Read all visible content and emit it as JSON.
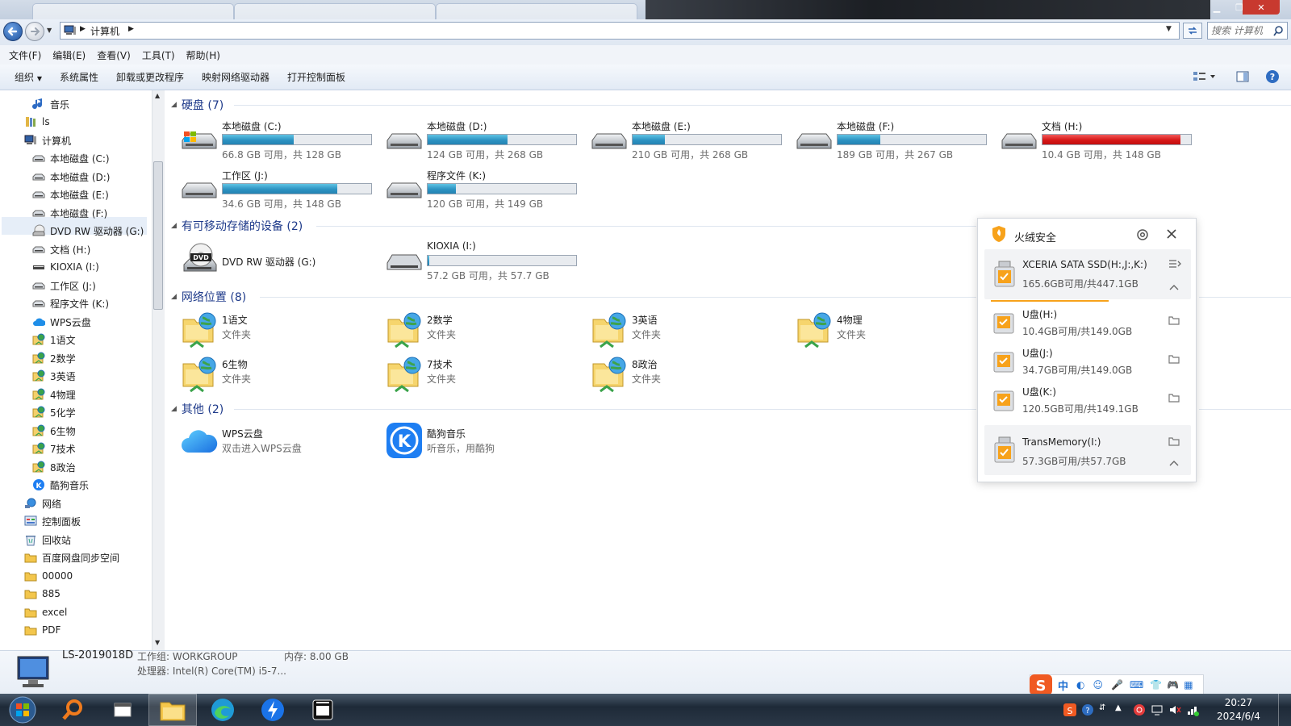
{
  "window": {
    "address_path": "计算机",
    "search_placeholder": "搜索 计算机"
  },
  "menu": [
    "文件(F)",
    "编辑(E)",
    "查看(V)",
    "工具(T)",
    "帮助(H)"
  ],
  "toolbar": {
    "organize": "组织",
    "items": [
      "系统属性",
      "卸载或更改程序",
      "映射网络驱动器",
      "打开控制面板"
    ]
  },
  "nav": [
    {
      "label": "音乐",
      "icon": "music-icon"
    },
    {
      "label": "ls",
      "icon": "library-icon"
    },
    {
      "label": "计算机",
      "icon": "computer-icon"
    },
    {
      "label": "本地磁盘 (C:)",
      "icon": "drive-icon"
    },
    {
      "label": "本地磁盘 (D:)",
      "icon": "drive-icon"
    },
    {
      "label": "本地磁盘 (E:)",
      "icon": "drive-icon"
    },
    {
      "label": "本地磁盘 (F:)",
      "icon": "drive-icon"
    },
    {
      "label": "DVD RW 驱动器 (G:)",
      "icon": "dvd-icon"
    },
    {
      "label": "文档 (H:)",
      "icon": "drive-icon"
    },
    {
      "label": "KIOXIA (I:)",
      "icon": "usb-drive-icon"
    },
    {
      "label": "工作区 (J:)",
      "icon": "drive-icon"
    },
    {
      "label": "程序文件 (K:)",
      "icon": "drive-icon"
    },
    {
      "label": "WPS云盘",
      "icon": "cloud-icon"
    },
    {
      "label": "1语文",
      "icon": "network-folder-icon"
    },
    {
      "label": "2数学",
      "icon": "network-folder-icon"
    },
    {
      "label": "3英语",
      "icon": "network-folder-icon"
    },
    {
      "label": "4物理",
      "icon": "network-folder-icon"
    },
    {
      "label": "5化学",
      "icon": "network-folder-icon"
    },
    {
      "label": "6生物",
      "icon": "network-folder-icon"
    },
    {
      "label": "7技术",
      "icon": "network-folder-icon"
    },
    {
      "label": "8政治",
      "icon": "network-folder-icon"
    },
    {
      "label": "酷狗音乐",
      "icon": "kugou-icon"
    },
    {
      "label": "网络",
      "icon": "network-icon"
    },
    {
      "label": "控制面板",
      "icon": "control-panel-icon"
    },
    {
      "label": "回收站",
      "icon": "recycle-bin-icon"
    },
    {
      "label": "百度网盘同步空间",
      "icon": "folder-icon"
    },
    {
      "label": "00000",
      "icon": "folder-icon"
    },
    {
      "label": "885",
      "icon": "folder-icon"
    },
    {
      "label": "excel",
      "icon": "folder-icon"
    },
    {
      "label": "PDF",
      "icon": "folder-icon"
    }
  ],
  "groups": {
    "hard_disks": "硬盘 (7)",
    "removable": "有可移动存储的设备 (2)",
    "network": "网络位置 (8)",
    "other": "其他 (2)"
  },
  "drives": [
    {
      "name": "本地磁盘 (C:)",
      "free": "66.8 GB 可用，共 128 GB",
      "used_fraction": 0.48,
      "status": "normal",
      "icon": "windows-drive-icon"
    },
    {
      "name": "本地磁盘 (D:)",
      "free": "124 GB 可用，共 268 GB",
      "used_fraction": 0.54,
      "status": "normal",
      "icon": "hard-drive-icon"
    },
    {
      "name": "本地磁盘 (E:)",
      "free": "210 GB 可用，共 268 GB",
      "used_fraction": 0.22,
      "status": "normal",
      "icon": "hard-drive-icon"
    },
    {
      "name": "本地磁盘 (F:)",
      "free": "189 GB 可用，共 267 GB",
      "used_fraction": 0.29,
      "status": "normal",
      "icon": "hard-drive-icon"
    },
    {
      "name": "文档 (H:)",
      "free": "10.4 GB 可用，共 148 GB",
      "used_fraction": 0.93,
      "status": "full",
      "icon": "hard-drive-icon"
    },
    {
      "name": "工作区 (J:)",
      "free": "34.6 GB 可用，共 148 GB",
      "used_fraction": 0.77,
      "status": "normal",
      "icon": "hard-drive-icon"
    },
    {
      "name": "程序文件 (K:)",
      "free": "120 GB 可用，共 149 GB",
      "used_fraction": 0.19,
      "status": "normal",
      "icon": "hard-drive-icon"
    }
  ],
  "removable_devices": [
    {
      "name": "DVD RW 驱动器 (G:)",
      "icon": "dvd-drive-icon"
    },
    {
      "name": "KIOXIA (I:)",
      "free": "57.2 GB 可用，共 57.7 GB",
      "used_fraction": 0.01,
      "icon": "usb-drive-icon"
    }
  ],
  "network_locations": [
    {
      "name": "1语文",
      "sub": "文件夹"
    },
    {
      "name": "2数学",
      "sub": "文件夹"
    },
    {
      "name": "3英语",
      "sub": "文件夹"
    },
    {
      "name": "4物理",
      "sub": "文件夹"
    },
    {
      "name": "6生物",
      "sub": "文件夹"
    },
    {
      "name": "7技术",
      "sub": "文件夹"
    },
    {
      "name": "8政治",
      "sub": "文件夹"
    }
  ],
  "other_items": [
    {
      "name": "WPS云盘",
      "sub": "双击进入WPS云盘",
      "icon": "wps-cloud-icon"
    },
    {
      "name": "酷狗音乐",
      "sub": "听音乐，用酷狗",
      "icon": "kugou-icon"
    }
  ],
  "popup": {
    "title": "火绒安全",
    "devices": [
      {
        "name": "XCERIA SATA SSD(H:,J:,K:)",
        "info": "165.6GB可用/共447.1GB"
      },
      {
        "name": "U盘(H:)",
        "info": "10.4GB可用/共149.0GB"
      },
      {
        "name": "U盘(J:)",
        "info": "34.7GB可用/共149.0GB"
      },
      {
        "name": "U盘(K:)",
        "info": "120.5GB可用/共149.1GB"
      },
      {
        "name": "TransMemory(I:)",
        "info": "57.3GB可用/共57.7GB"
      }
    ]
  },
  "details": {
    "computer_name": "LS-2019018D",
    "workgroup": "工作组: WORKGROUP",
    "memory": "内存: 8.00 GB",
    "processor": "处理器: Intel(R) Core(TM) i5-7..."
  },
  "ime": {
    "mode": "中"
  },
  "clock": {
    "time": "20:27",
    "date": "2024/6/4"
  },
  "colors": {
    "accent": "#2d93c2",
    "danger": "#d81818",
    "huorong": "#f7a21b"
  }
}
